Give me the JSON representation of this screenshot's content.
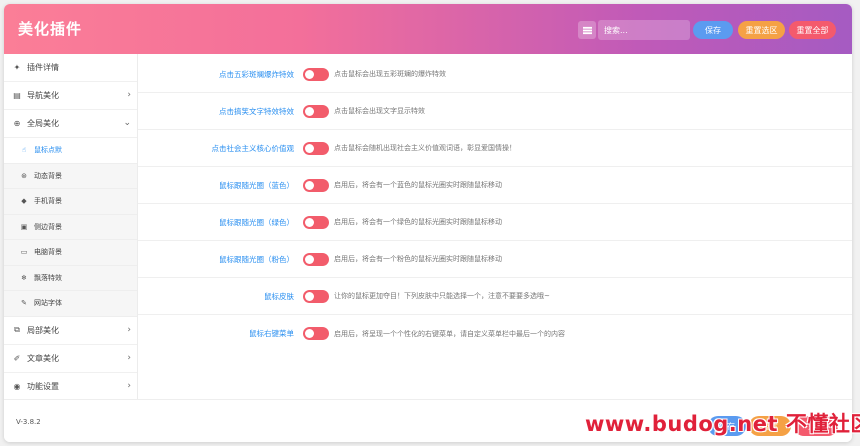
{
  "header": {
    "title": "美化插件",
    "search_placeholder": "搜索...",
    "save_label": "保存",
    "reset_selected_label": "重置选区",
    "reset_all_label": "重置全部"
  },
  "sidebar": {
    "items": [
      {
        "label": "插件详情",
        "icon": "plugin-icon"
      },
      {
        "label": "导航美化",
        "icon": "nav-list-icon"
      },
      {
        "label": "全局美化",
        "icon": "globe-icon"
      }
    ],
    "subitems": [
      {
        "label": "鼠标点默",
        "icon": "pointer-hand-icon"
      },
      {
        "label": "动态背景",
        "icon": "dynamic-bg-icon"
      },
      {
        "label": "手机背景",
        "icon": "mobile-icon"
      },
      {
        "label": "侧边背景",
        "icon": "image-icon"
      },
      {
        "label": "电脑背景",
        "icon": "monitor-icon"
      },
      {
        "label": "飘落特效",
        "icon": "snowflake-icon"
      },
      {
        "label": "网站字体",
        "icon": "brush-icon"
      }
    ],
    "bottom_items": [
      {
        "label": "局部美化",
        "icon": "layout-icon"
      },
      {
        "label": "文章美化",
        "icon": "edit-icon"
      },
      {
        "label": "功能设置",
        "icon": "settings-icon"
      }
    ]
  },
  "settings": [
    {
      "label": "点击五彩斑斓爆炸特效",
      "desc": "点击鼠标会出现五彩斑斓的爆炸特效"
    },
    {
      "label": "点击搞笑文字特效特效",
      "desc": "点击鼠标会出现文字显示特效"
    },
    {
      "label": "点击社会主义核心价值观",
      "desc": "点击鼠标会随机出现社会主义价值观词语，彰显爱国情操！"
    },
    {
      "label": "鼠标跟随光圈（蓝色）",
      "desc": "启用后，将会有一个蓝色的鼠标光圈实时跟随鼠标移动"
    },
    {
      "label": "鼠标跟随光圈（绿色）",
      "desc": "启用后，将会有一个绿色的鼠标光圈实时跟随鼠标移动"
    },
    {
      "label": "鼠标跟随光圈（粉色）",
      "desc": "启用后，将会有一个粉色的鼠标光圈实时跟随鼠标移动"
    },
    {
      "label": "鼠标皮肤",
      "desc": "让你的鼠标更加夺目！下列皮肤中只能选择一个，注意不要要多选哦~"
    },
    {
      "label": "鼠标右键菜单",
      "desc": "启用后，将呈现一个个性化的右键菜单，请自定义菜单栏中最后一个的内容"
    }
  ],
  "footer": {
    "version": "V-3.8.2",
    "save_label": "保存",
    "reset_selected_label": "重置",
    "reset_all_label": "重置",
    "watermark": "www.budog.net 不懂社区"
  },
  "colors": {
    "accent": "#2a8ff0",
    "toggle_off": "#f25c6b",
    "save_button": "#5b9bf0",
    "reset_selected_button": "#f5a145",
    "reset_all_button": "#f45a6d"
  }
}
